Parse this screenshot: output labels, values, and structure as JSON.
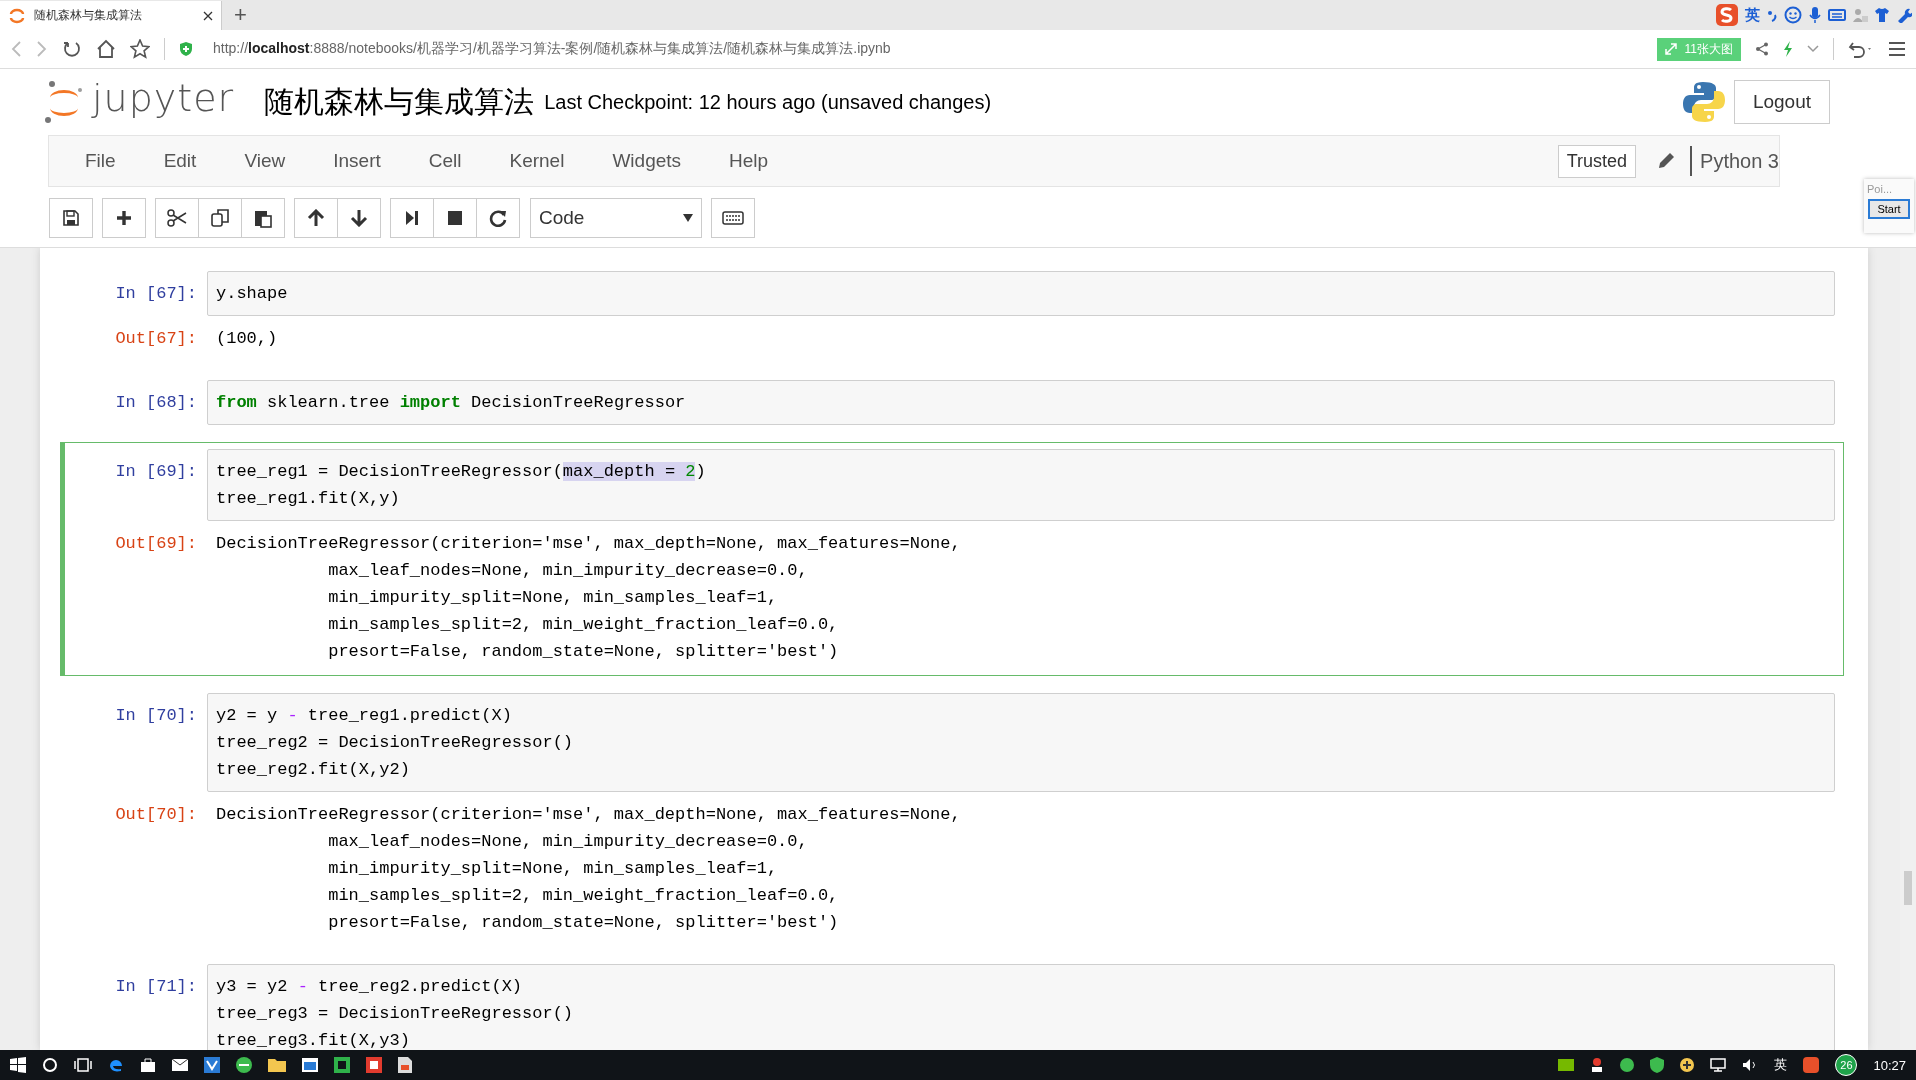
{
  "browser": {
    "tab": {
      "title": "随机森林与集成算法",
      "selected": true
    },
    "new_tab": "+",
    "url": "http://**localhost**:8888/notebooks/机器学习/机器学习算法-案例/随机森林与集成算法/随机森林与集成算法.ipynb",
    "extension_button": "11张大图",
    "ime_indicator": "英"
  },
  "notebook": {
    "logo_text": "jupyter",
    "title": "随机森林与集成算法",
    "checkpoint": "Last Checkpoint: 12 hours ago (unsaved changes)",
    "logout": "Logout",
    "menu": [
      "File",
      "Edit",
      "View",
      "Insert",
      "Cell",
      "Kernel",
      "Widgets",
      "Help"
    ],
    "trusted": "Trusted",
    "kernel": "Python 3",
    "cell_type": "Code"
  },
  "popup": {
    "label": "Poi...",
    "button": "Start"
  },
  "cells": [
    {
      "prompt": "In [67]:",
      "selected": false,
      "code": [
        [
          {
            "text": "y.shape",
            "kind": "plain"
          }
        ]
      ],
      "out_prompt": "Out[67]:",
      "output": [
        "(100,)"
      ]
    },
    {
      "prompt": "In [68]:",
      "selected": false,
      "code": [
        [
          {
            "text": "from",
            "kind": "keyword"
          },
          {
            "text": " sklearn.tree ",
            "kind": "plain"
          },
          {
            "text": "import",
            "kind": "keyword"
          },
          {
            "text": " DecisionTreeRegressor",
            "kind": "plain"
          }
        ]
      ]
    },
    {
      "prompt": "In [69]:",
      "selected": true,
      "code": [
        [
          {
            "text": "tree_reg1 = DecisionTreeRegressor(",
            "kind": "plain"
          },
          {
            "text": "max_depth = ",
            "kind": "selection"
          },
          {
            "text": "2",
            "kind": "selected-number"
          },
          {
            "text": ")",
            "kind": "plain"
          }
        ],
        [
          {
            "text": "tree_reg1.fit(X,y)",
            "kind": "plain"
          }
        ]
      ],
      "out_prompt": "Out[69]:",
      "output": [
        "DecisionTreeRegressor(criterion='mse', max_depth=None, max_features=None,",
        "           max_leaf_nodes=None, min_impurity_decrease=0.0,",
        "           min_impurity_split=None, min_samples_leaf=1,",
        "           min_samples_split=2, min_weight_fraction_leaf=0.0,",
        "           presort=False, random_state=None, splitter='best')"
      ]
    },
    {
      "prompt": "In [70]:",
      "selected": false,
      "code": [
        [
          {
            "text": "y2 = y ",
            "kind": "plain"
          },
          {
            "text": "-",
            "kind": "operator"
          },
          {
            "text": " tree_reg1.predict(X)",
            "kind": "plain"
          }
        ],
        [
          {
            "text": "tree_reg2 = DecisionTreeRegressor()",
            "kind": "plain"
          }
        ],
        [
          {
            "text": "tree_reg2.fit(X,y2)",
            "kind": "plain"
          }
        ]
      ],
      "out_prompt": "Out[70]:",
      "output": [
        "DecisionTreeRegressor(criterion='mse', max_depth=None, max_features=None,",
        "           max_leaf_nodes=None, min_impurity_decrease=0.0,",
        "           min_impurity_split=None, min_samples_leaf=1,",
        "           min_samples_split=2, min_weight_fraction_leaf=0.0,",
        "           presort=False, random_state=None, splitter='best')"
      ]
    },
    {
      "prompt": "In [71]:",
      "selected": false,
      "code": [
        [
          {
            "text": "y3 = y2 ",
            "kind": "plain"
          },
          {
            "text": "-",
            "kind": "operator"
          },
          {
            "text": " tree_reg2.predict(X)",
            "kind": "plain"
          }
        ],
        [
          {
            "text": "tree_reg3 = DecisionTreeRegressor()",
            "kind": "plain"
          }
        ],
        [
          {
            "text": "tree_reg3.fit(X,y3)",
            "kind": "plain"
          }
        ]
      ]
    }
  ],
  "taskbar": {
    "tray_language": "英",
    "badge": "26",
    "clock": "10:27"
  }
}
